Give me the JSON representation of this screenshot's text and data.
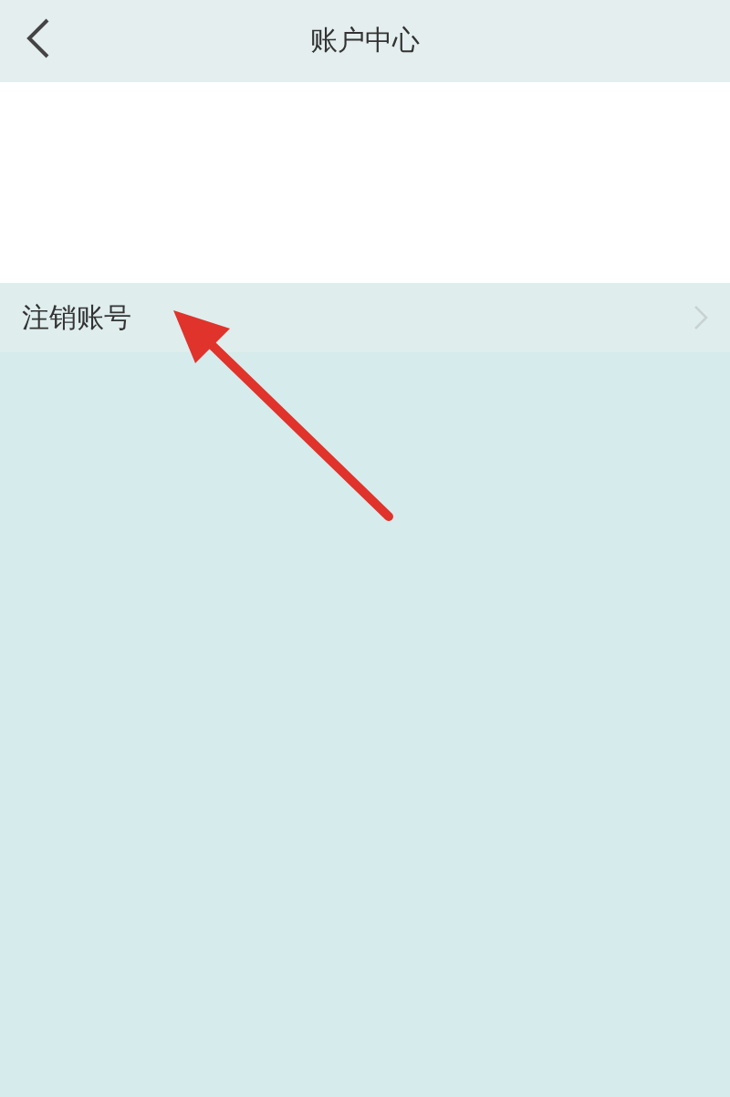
{
  "header": {
    "title": "账户中心"
  },
  "menu": [
    {
      "label": "注销账号"
    }
  ],
  "annotation": {
    "kind": "arrow"
  }
}
